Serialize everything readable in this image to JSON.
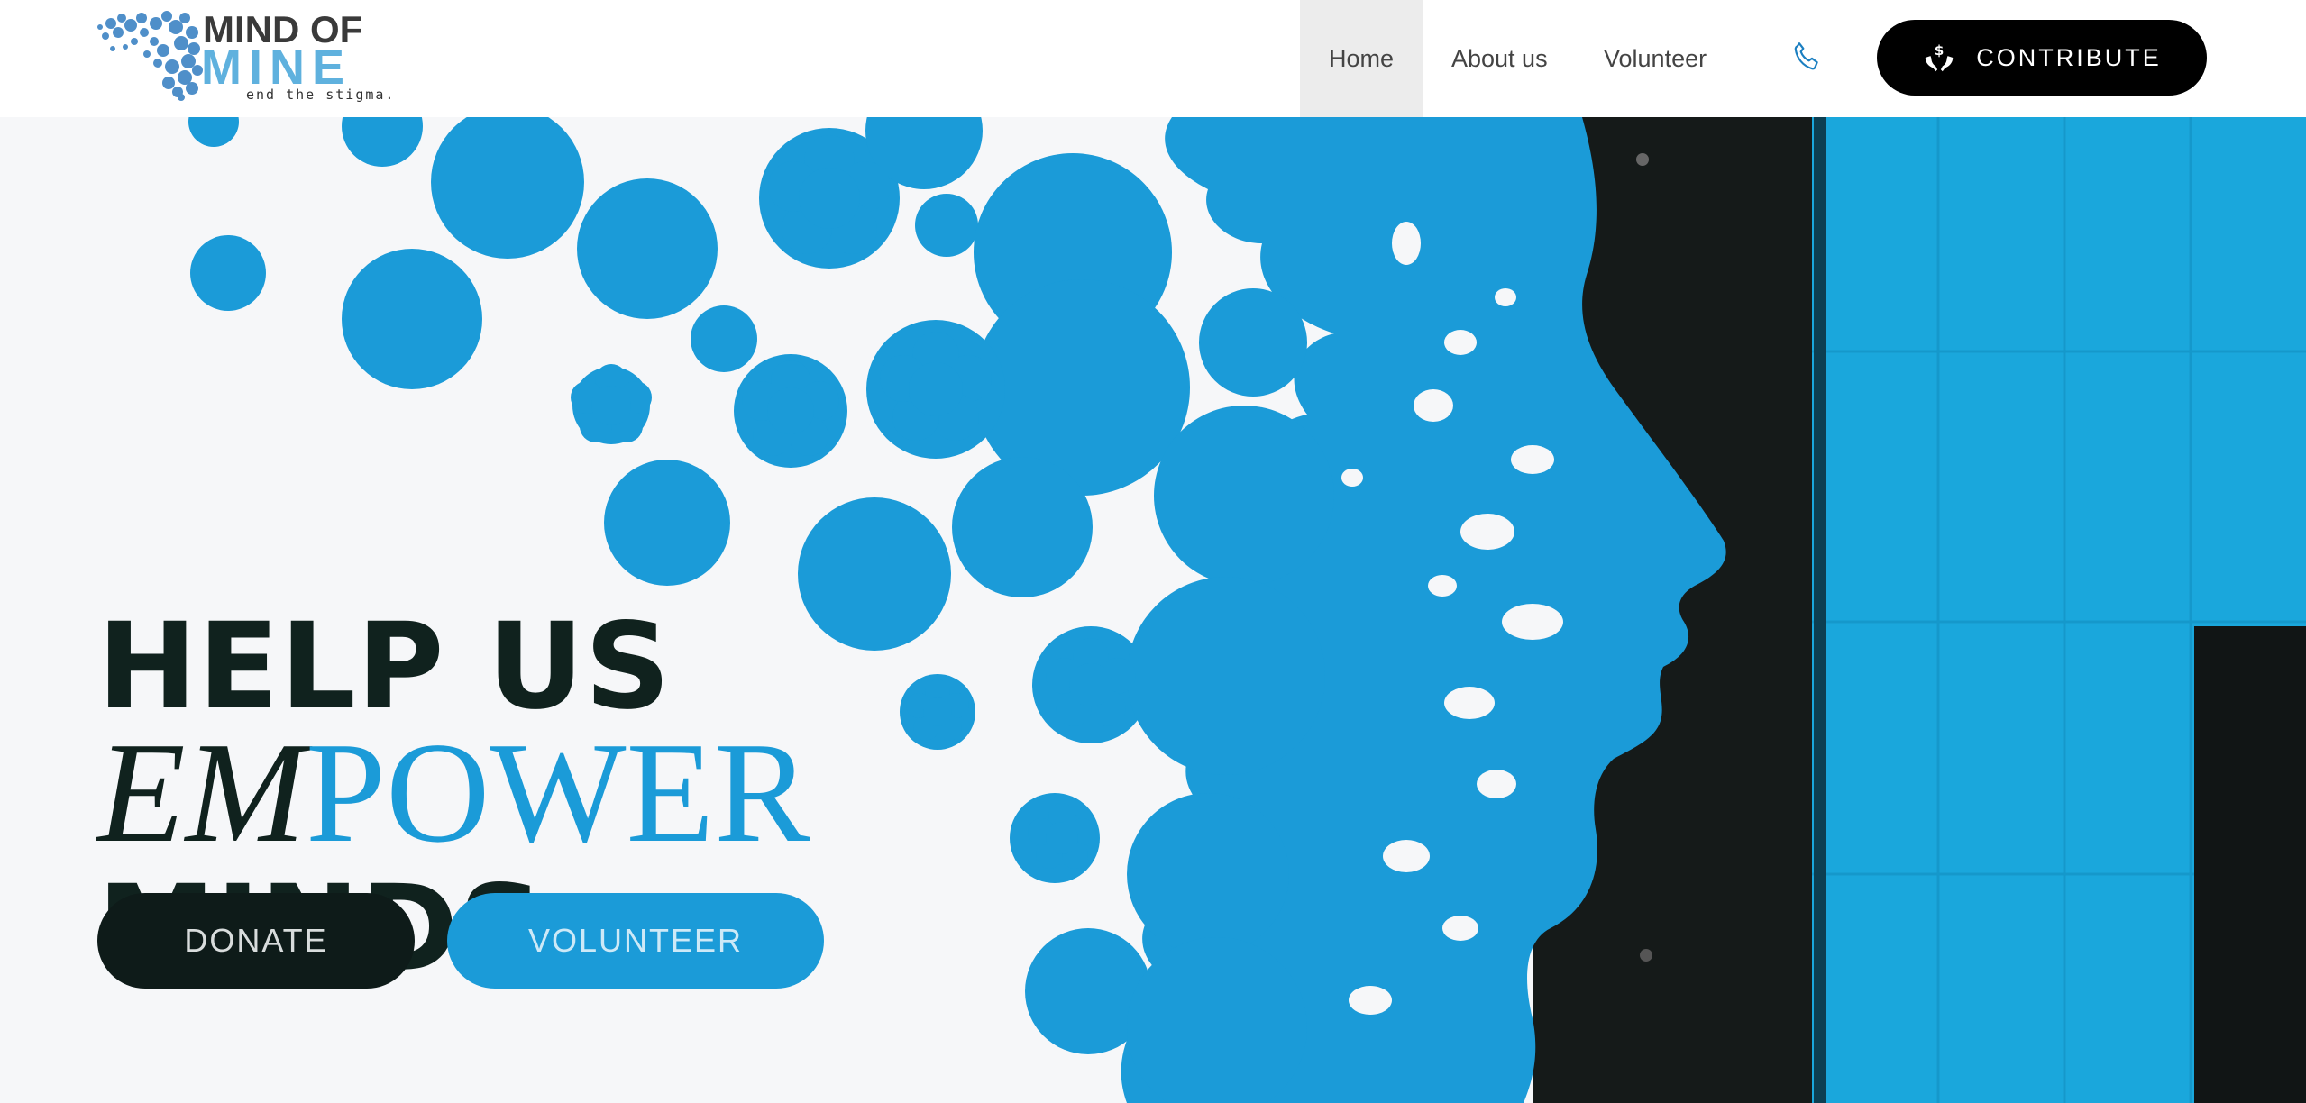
{
  "logo": {
    "line1": "MIND OF",
    "line2": "MINE",
    "tagline": "end the stigma."
  },
  "nav": {
    "home": "Home",
    "about": "About us",
    "volunteer": "Volunteer",
    "phone_icon": "phone-icon",
    "contribute": "CONTRIBUTE",
    "contribute_icon": "donate-hands-icon"
  },
  "hero": {
    "line1": "HELP US",
    "line2_em": "EM",
    "line2_power": "POWER",
    "line3": "MINDS.",
    "donate_button": "DONATE",
    "volunteer_button": "VOLUNTEER"
  },
  "colors": {
    "accent_blue": "#1b9bd8",
    "dark": "#10221e",
    "black": "#000000"
  }
}
